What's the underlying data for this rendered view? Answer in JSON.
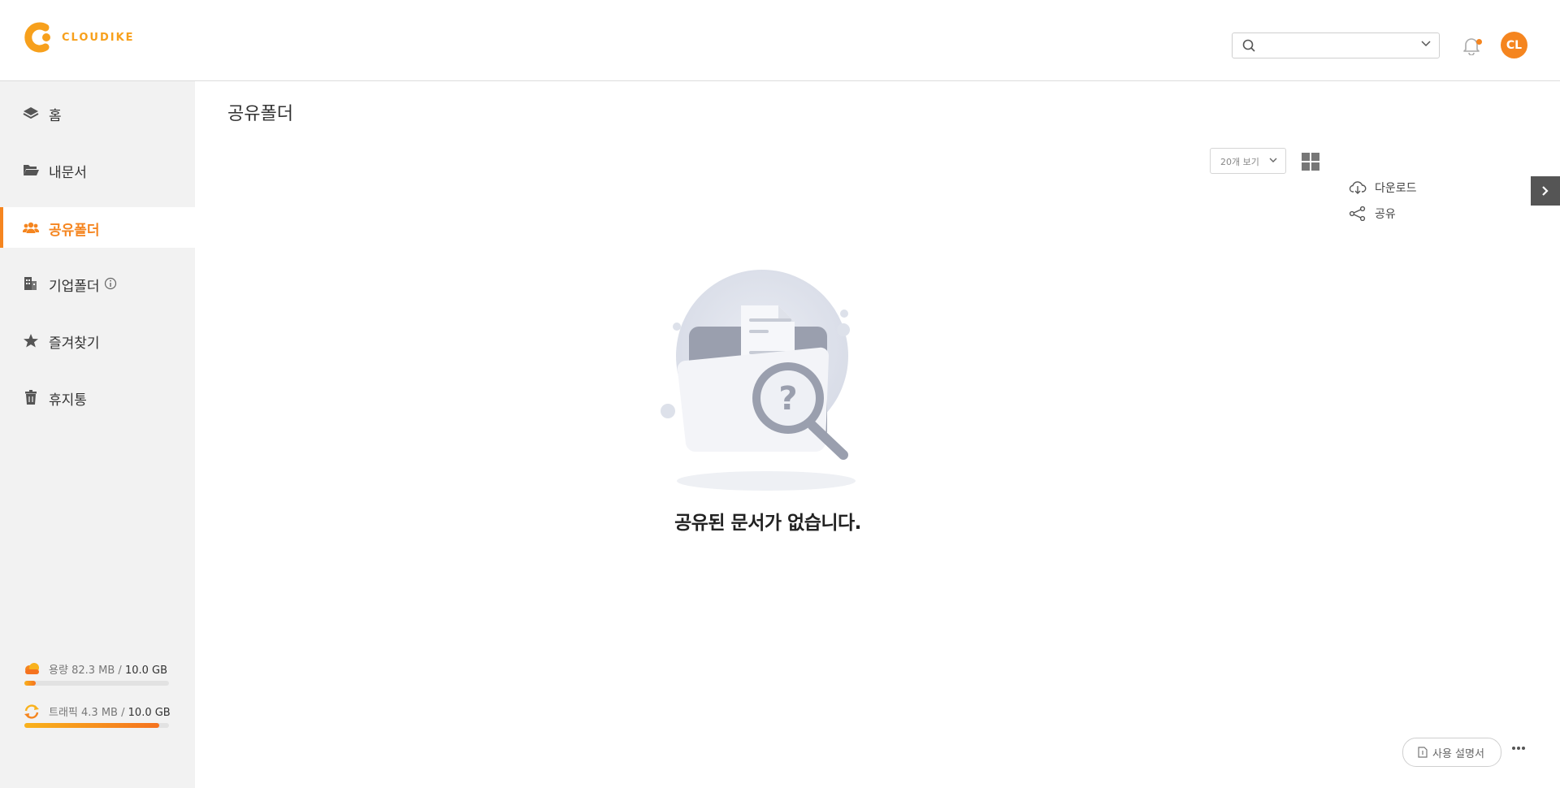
{
  "brand": {
    "name": "CLOUDIKE",
    "accent": "#f5851f"
  },
  "header": {
    "search": {
      "value": "",
      "placeholder": ""
    },
    "user_initials": "CL",
    "has_notification": true
  },
  "sidebar": {
    "items": [
      {
        "label": "홈",
        "icon": "layers-icon",
        "active": false
      },
      {
        "label": "내문서",
        "icon": "folder-open-icon",
        "active": false
      },
      {
        "label": "공유폴더",
        "icon": "users-icon",
        "active": true
      },
      {
        "label": "기업폴더",
        "icon": "building-icon",
        "active": false
      },
      {
        "label": "즐겨찾기",
        "icon": "star-icon",
        "active": false
      },
      {
        "label": "휴지통",
        "icon": "trash-icon",
        "active": false
      }
    ],
    "storage": {
      "label": "용량",
      "used": "82.3 MB",
      "separator": "/",
      "total": "10.0 GB",
      "fraction": 0.08
    },
    "traffic": {
      "label": "트래픽",
      "used": "4.3 MB",
      "separator": "/",
      "total": "10.0 GB",
      "fraction": 0.93
    }
  },
  "main": {
    "title": "공유폴더",
    "per_page": "20개 보기",
    "actions": {
      "download": "다운로드",
      "share": "공유"
    },
    "empty_message": "공유된 문서가 없습니다."
  },
  "footer": {
    "manual": "사용 설명서"
  }
}
